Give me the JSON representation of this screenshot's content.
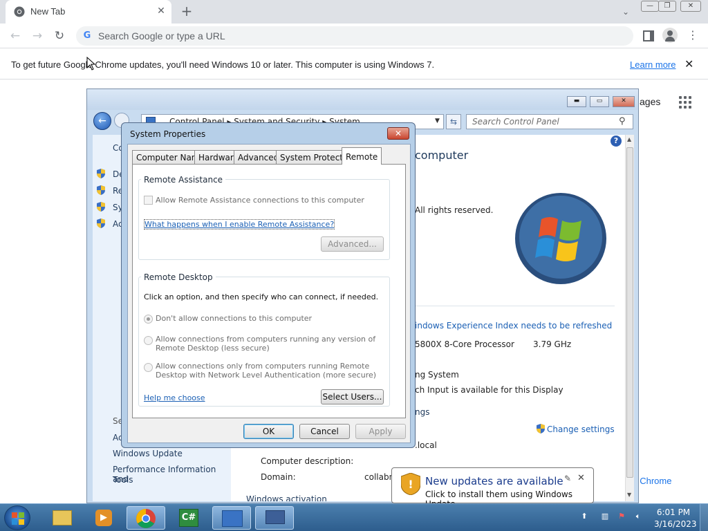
{
  "chrome": {
    "tab_title": "New Tab",
    "omnibox_placeholder": "Search Google or type a URL",
    "infobar_message": "To get future Google Chrome updates, you'll need Windows 10 or later. This computer is using Windows 7.",
    "infobar_link": "Learn more",
    "ntp_images": "ages",
    "ntp_customize": "ize Chrome"
  },
  "control_panel": {
    "breadcrumb": "Control Panel  ▸  System and Security  ▸  System",
    "search_placeholder": "Search Control Panel",
    "left_items": [
      "De",
      "Re",
      "Sy",
      "Ac"
    ],
    "left_heading_top": "Co",
    "left_heading_see": "Se",
    "left_bottom_items": [
      "Ac",
      "Windows Update",
      "Performance Information and",
      "Tools"
    ],
    "main_heading": "computer",
    "rights": "All rights reserved.",
    "wei_link": "indows Experience Index needs to be refreshed",
    "processor": "5800X 8-Core Processor",
    "speed": "3.79 GHz",
    "os_type": "ng System",
    "pen": "ch Input is available for this Display",
    "settings_heading": "ngs",
    "change_settings": "Change settings",
    "domain_suffix": ".local",
    "computer_description_label": "Computer description:",
    "domain_label": "Domain:",
    "domain_value": "collabn",
    "truncated_bottom": "Windows activation"
  },
  "system_properties": {
    "title": "System Properties",
    "tabs": [
      "Computer Name",
      "Hardware",
      "Advanced",
      "System Protection",
      "Remote"
    ],
    "active_tab": "Remote",
    "remote_assistance": {
      "group_title": "Remote Assistance",
      "checkbox_label": "Allow Remote Assistance connections to this computer",
      "help_link": "What happens when I enable Remote Assistance?",
      "advanced_button": "Advanced..."
    },
    "remote_desktop": {
      "group_title": "Remote Desktop",
      "instruction": "Click an option, and then specify who can connect, if needed.",
      "option1": "Don't allow connections to this computer",
      "option2_line1": "Allow connections from computers running any version of",
      "option2_line2": "Remote Desktop (less secure)",
      "option3_line1": "Allow connections only from computers running Remote",
      "option3_line2": "Desktop with Network Level Authentication (more secure)",
      "help_link": "Help me choose",
      "select_users_button": "Select Users..."
    },
    "ok": "OK",
    "cancel": "Cancel",
    "apply": "Apply"
  },
  "notification": {
    "title": "New updates are available",
    "body": "Click to install them using Windows Update."
  },
  "taskbar": {
    "time": "6:01 PM",
    "date": "3/16/2023",
    "apps": [
      "file-explorer",
      "media-player",
      "chrome",
      "csharp-app",
      "control-panel",
      "remote-desktop"
    ]
  }
}
